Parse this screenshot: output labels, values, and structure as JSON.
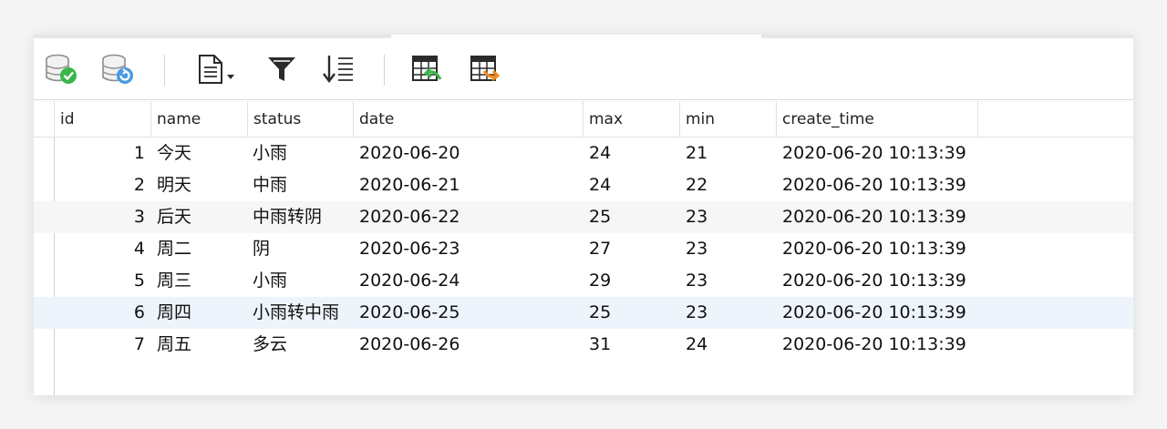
{
  "toolbar": {
    "icons": [
      "db-commit-icon",
      "db-refresh-icon",
      "document-icon",
      "filter-icon",
      "sort-icon",
      "table-import-icon",
      "table-export-icon"
    ]
  },
  "table": {
    "columns": [
      "id",
      "name",
      "status",
      "date",
      "max",
      "min",
      "create_time"
    ],
    "rows": [
      {
        "id": "1",
        "name": "今天",
        "status": "小雨",
        "date": "2020-06-20",
        "max": "24",
        "min": "21",
        "create_time": "2020-06-20 10:13:39"
      },
      {
        "id": "2",
        "name": "明天",
        "status": "中雨",
        "date": "2020-06-21",
        "max": "24",
        "min": "22",
        "create_time": "2020-06-20 10:13:39"
      },
      {
        "id": "3",
        "name": "后天",
        "status": "中雨转阴",
        "date": "2020-06-22",
        "max": "25",
        "min": "23",
        "create_time": "2020-06-20 10:13:39"
      },
      {
        "id": "4",
        "name": "周二",
        "status": "阴",
        "date": "2020-06-23",
        "max": "27",
        "min": "23",
        "create_time": "2020-06-20 10:13:39"
      },
      {
        "id": "5",
        "name": "周三",
        "status": "小雨",
        "date": "2020-06-24",
        "max": "29",
        "min": "23",
        "create_time": "2020-06-20 10:13:39"
      },
      {
        "id": "6",
        "name": "周四",
        "status": "小雨转中雨",
        "date": "2020-06-25",
        "max": "25",
        "min": "23",
        "create_time": "2020-06-20 10:13:39"
      },
      {
        "id": "7",
        "name": "周五",
        "status": "多云",
        "date": "2020-06-26",
        "max": "31",
        "min": "24",
        "create_time": "2020-06-20 10:13:39"
      }
    ],
    "selected_row": 6
  },
  "colors": {
    "accent_green": "#3cb64a",
    "accent_blue": "#4a9be0",
    "accent_orange": "#f08a1c"
  }
}
